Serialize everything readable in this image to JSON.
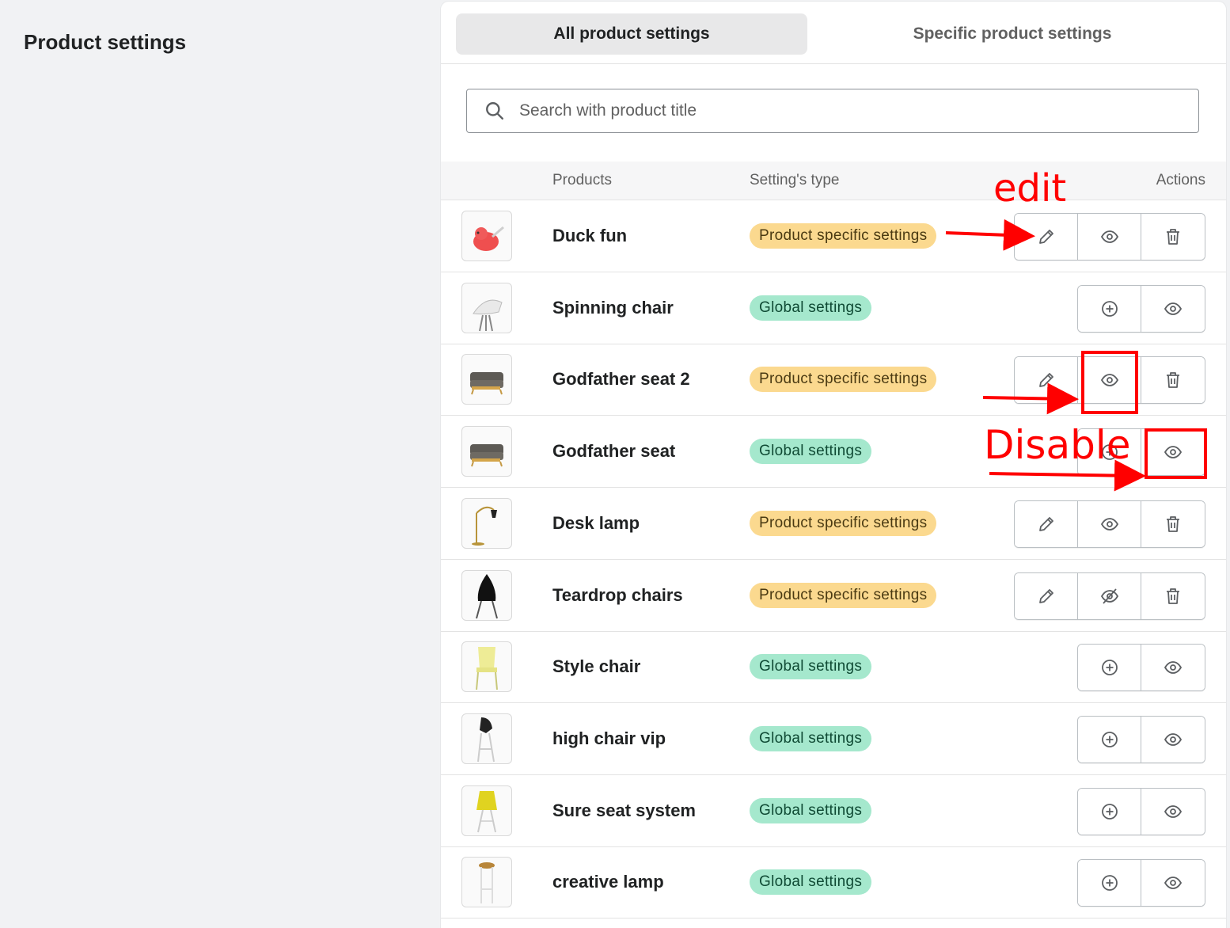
{
  "page": {
    "title": "Product settings"
  },
  "tabs": [
    {
      "label": "All product settings",
      "active": true
    },
    {
      "label": "Specific product settings",
      "active": false
    }
  ],
  "search": {
    "placeholder": "Search with product title",
    "value": ""
  },
  "table": {
    "headers": {
      "products": "Products",
      "type": "Setting's type",
      "actions": "Actions"
    },
    "rows": [
      {
        "name": "Duck fun",
        "type": "Product specific settings",
        "kind": "ps",
        "thumb": "duck"
      },
      {
        "name": "Spinning chair",
        "type": "Global settings",
        "kind": "gs",
        "thumb": "white-chair"
      },
      {
        "name": "Godfather seat 2",
        "type": "Product specific settings",
        "kind": "ps",
        "thumb": "sofa"
      },
      {
        "name": "Godfather seat",
        "type": "Global settings",
        "kind": "gs",
        "thumb": "sofa"
      },
      {
        "name": "Desk lamp",
        "type": "Product specific settings",
        "kind": "ps",
        "thumb": "lamp"
      },
      {
        "name": "Teardrop chairs",
        "type": "Product specific settings",
        "kind": "ps",
        "thumb": "teardrop",
        "hidden": true
      },
      {
        "name": "Style chair",
        "type": "Global settings",
        "kind": "gs",
        "thumb": "yellow-chair"
      },
      {
        "name": "high chair vip",
        "type": "Global settings",
        "kind": "gs",
        "thumb": "high-chair"
      },
      {
        "name": "Sure seat system",
        "type": "Global settings",
        "kind": "gs",
        "thumb": "yellow-seat"
      },
      {
        "name": "creative lamp",
        "type": "Global settings",
        "kind": "gs",
        "thumb": "stool"
      }
    ]
  },
  "annotations": {
    "edit": "edit",
    "disable": "Disable"
  },
  "colors": {
    "product_specific_badge": "#fbd98f",
    "global_badge": "#a5e8cd",
    "annotation": "#ff0000"
  },
  "icons": {
    "product_specific_actions": [
      "pencil-icon",
      "eye-icon",
      "trash-icon"
    ],
    "global_actions": [
      "plus-circle-icon",
      "eye-icon"
    ],
    "hidden_state": "eye-slash-icon"
  }
}
